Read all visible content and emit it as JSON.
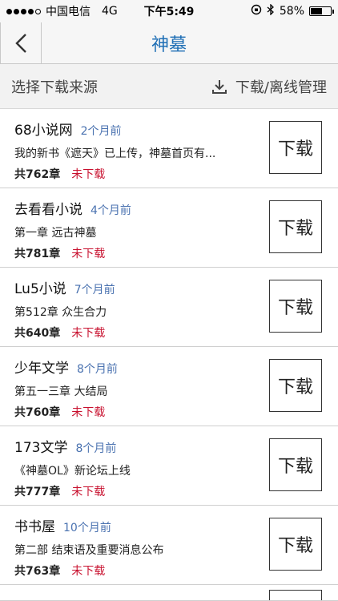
{
  "status_bar": {
    "carrier": "中国电信",
    "network": "4G",
    "time": "下午5:49",
    "battery": "58%",
    "battery_level": 0.58
  },
  "nav": {
    "title": "神墓"
  },
  "toolbar": {
    "source_label": "选择下载来源",
    "manage_label": "下载/离线管理"
  },
  "sources": [
    {
      "name": "68小说网",
      "time": "2个月前",
      "latest": "我的新书《遮天》已上传，神墓首页有...",
      "chapters": "共762章",
      "state": "未下载",
      "button": "下载"
    },
    {
      "name": "去看看小说",
      "time": "4个月前",
      "latest": "第一章 远古神墓",
      "chapters": "共781章",
      "state": "未下载",
      "button": "下载"
    },
    {
      "name": "Lu5小说",
      "time": "7个月前",
      "latest": "第512章 众生合力",
      "chapters": "共640章",
      "state": "未下载",
      "button": "下载"
    },
    {
      "name": "少年文学",
      "time": "8个月前",
      "latest": "第五一三章 大结局",
      "chapters": "共760章",
      "state": "未下载",
      "button": "下载"
    },
    {
      "name": "173文学",
      "time": "8个月前",
      "latest": "《神墓OL》新论坛上线",
      "chapters": "共777章",
      "state": "未下载",
      "button": "下载"
    },
    {
      "name": "书书屋",
      "time": "10个月前",
      "latest": "第二部 结束语及重要消息公布",
      "chapters": "共763章",
      "state": "未下载",
      "button": "下载"
    }
  ]
}
